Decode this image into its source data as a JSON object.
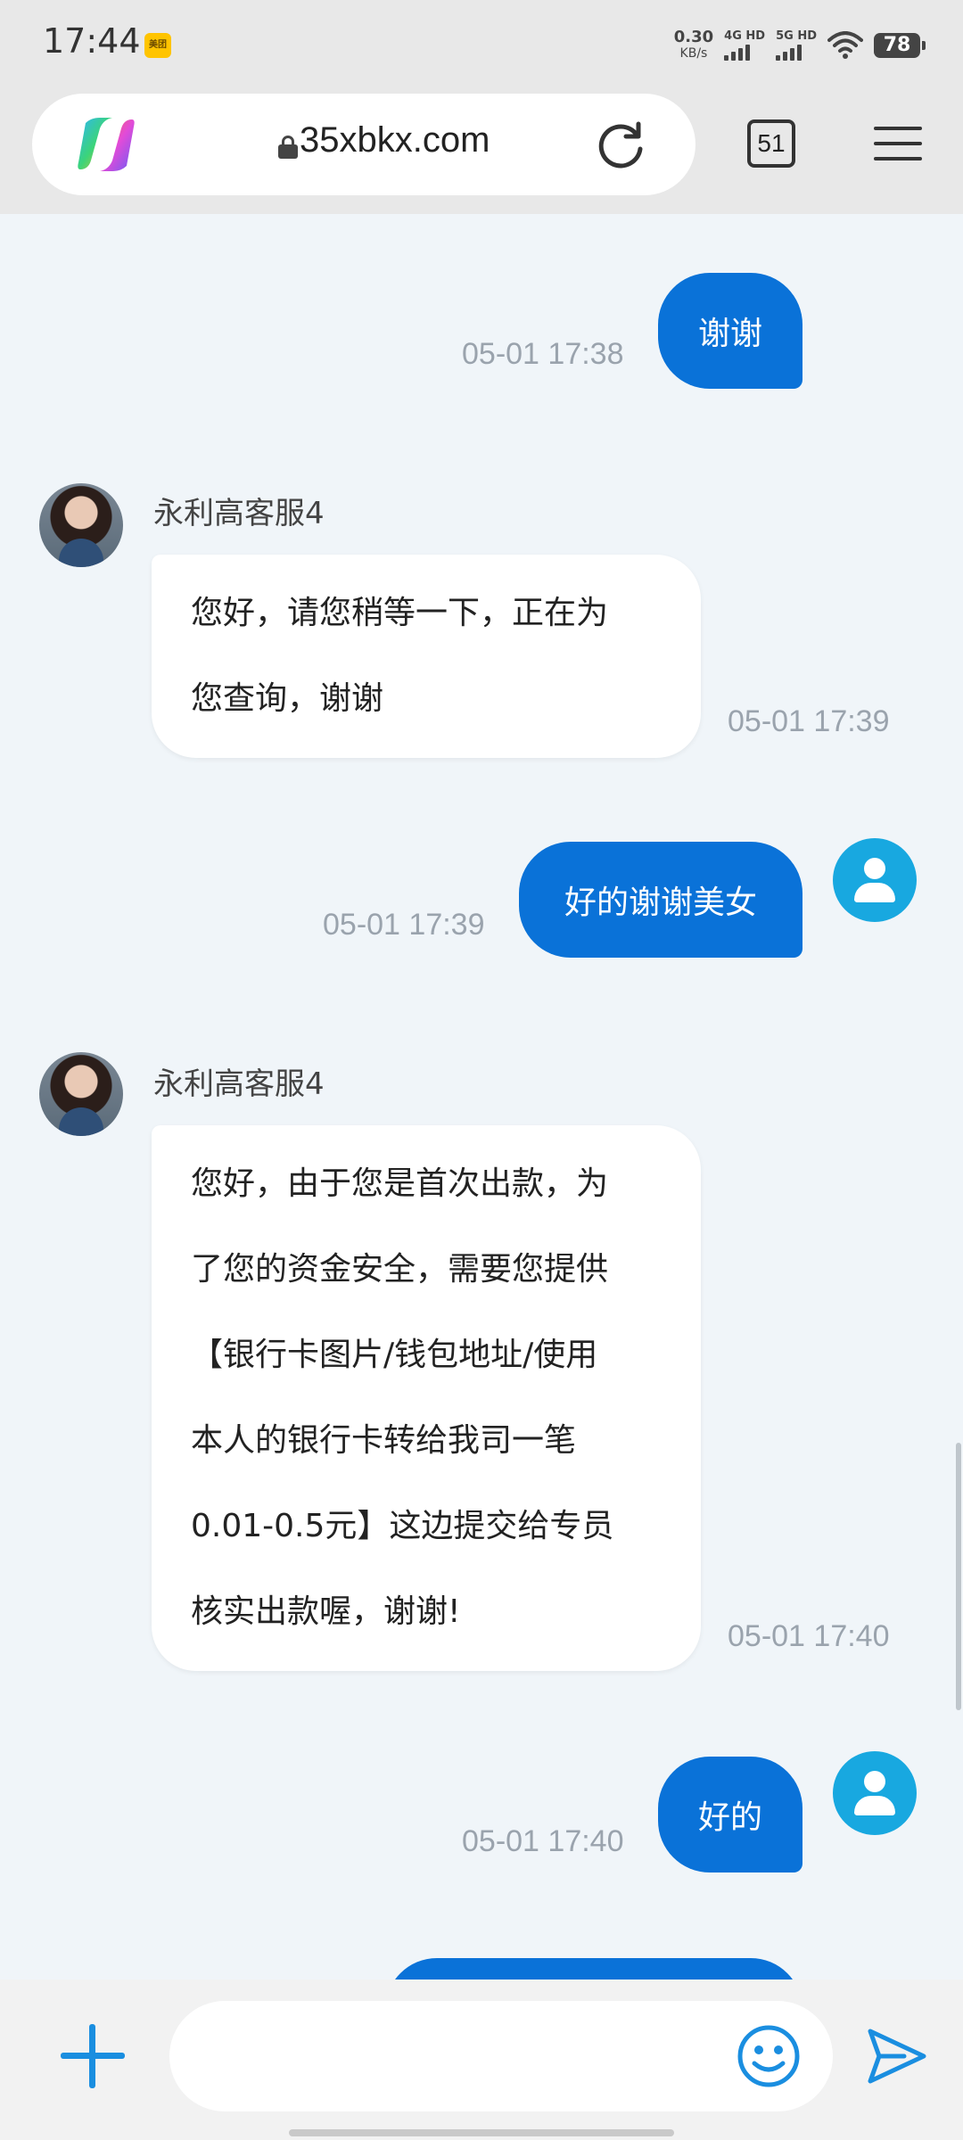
{
  "status_bar": {
    "time": "17:44",
    "app_badge": "美团",
    "net_speed_value": "0.30",
    "net_speed_unit": "KB/s",
    "sim1_label": "4G HD",
    "sim2_label": "5G HD",
    "battery": "78"
  },
  "browser": {
    "url": "35xbkx.com",
    "tab_count": "51"
  },
  "chat": {
    "messages": [
      {
        "direction": "out",
        "text": "谢谢",
        "time": "05-01 17:38"
      },
      {
        "direction": "in",
        "sender": "永利高客服4",
        "lines": [
          "您好，请您稍等一下，正在为",
          "您查询，谢谢"
        ],
        "time": "05-01 17:39"
      },
      {
        "direction": "out",
        "text": "好的谢谢美女",
        "time": "05-01 17:39"
      },
      {
        "direction": "in",
        "sender": "永利高客服4",
        "lines": [
          "您好，由于您是首次出款，为",
          "了您的资金安全，需要您提供",
          "【银行卡图片/钱包地址/使用",
          "本人的银行卡转给我司一笔",
          "0.01-0.5元】这边提交给专员",
          "核实出款喔，谢谢!"
        ],
        "time": "05-01 17:40"
      },
      {
        "direction": "out",
        "text": "好的",
        "time": "05-01 17:40"
      }
    ]
  },
  "input_bar": {
    "placeholder": ""
  },
  "colors": {
    "outgoing_bubble": "#0a72d8",
    "user_avatar": "#18a8e0",
    "accent": "#1a8ee0"
  }
}
